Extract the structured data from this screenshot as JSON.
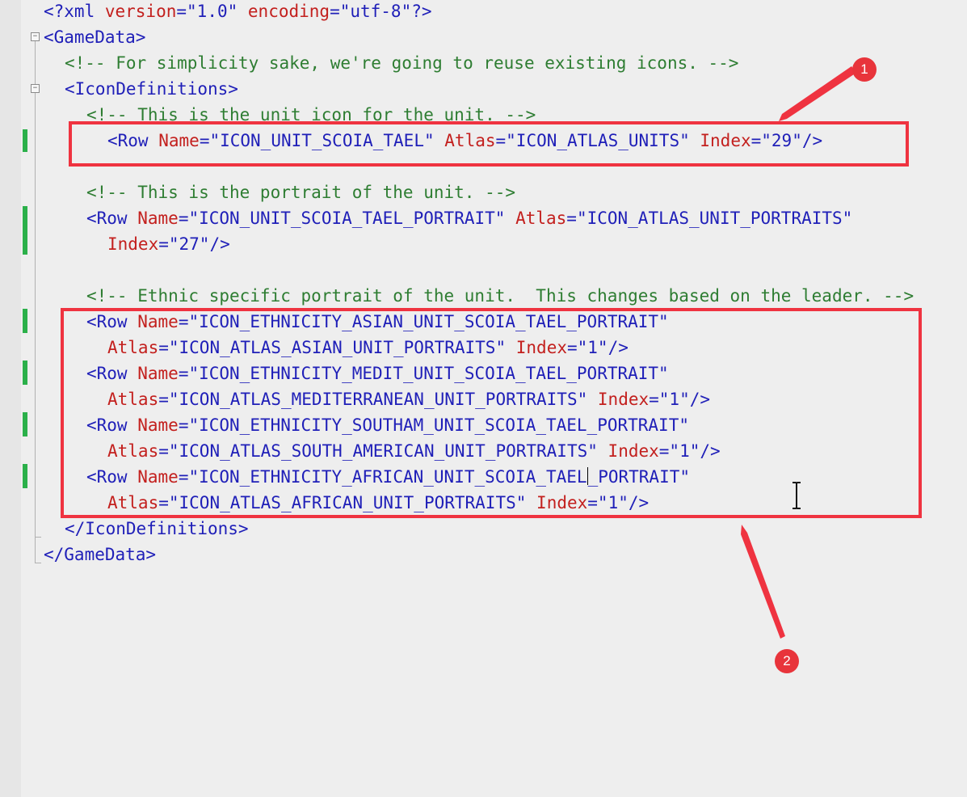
{
  "editor": {
    "declaration": {
      "open": "<?xml ",
      "version_attr": "version",
      "eq": "=",
      "version_val": "\"1.0\"",
      "encoding_attr": "encoding",
      "encoding_val": "\"utf-8\"",
      "close": "?>"
    },
    "root_open": "<GameData>",
    "root_close": "</GameData>",
    "comment_simplicity": "<!-- For simplicity sake, we're going to reuse existing icons. -->",
    "icondefs_open": "<IconDefinitions>",
    "icondefs_close": "</IconDefinitions>",
    "comment_unit_icon": "<!-- This is the unit icon for the unit. -->",
    "comment_portrait": "<!-- This is the portrait of the unit. -->",
    "comment_ethnic": "<!-- Ethnic specific portrait of the unit.  This changes based on the leader. -->",
    "row_tag": "<Row",
    "self_close": "/>",
    "name_attr": "Name",
    "atlas_attr": "Atlas",
    "index_attr": "Index",
    "rows": [
      {
        "name": "\"ICON_UNIT_SCOIA_TAEL\"",
        "atlas": "\"ICON_ATLAS_UNITS\"",
        "index": "\"29\""
      },
      {
        "name": "\"ICON_UNIT_SCOIA_TAEL_PORTRAIT\"",
        "atlas": "\"ICON_ATLAS_UNIT_PORTRAITS\"",
        "index": "\"27\""
      },
      {
        "name": "\"ICON_ETHNICITY_ASIAN_UNIT_SCOIA_TAEL_PORTRAIT\"",
        "atlas": "\"ICON_ATLAS_ASIAN_UNIT_PORTRAITS\"",
        "index": "\"1\""
      },
      {
        "name": "\"ICON_ETHNICITY_MEDIT_UNIT_SCOIA_TAEL_PORTRAIT\"",
        "atlas": "\"ICON_ATLAS_MEDITERRANEAN_UNIT_PORTRAITS\"",
        "index": "\"1\""
      },
      {
        "name": "\"ICON_ETHNICITY_SOUTHAM_UNIT_SCOIA_TAEL_PORTRAIT\"",
        "atlas": "\"ICON_ATLAS_SOUTH_AMERICAN_UNIT_PORTRAITS\"",
        "index": "\"1\""
      },
      {
        "name_before_caret": "\"ICON_ETHNICITY_AFRICAN_UNIT_SCOIA_TAEL",
        "name_after_caret": "_PORTRAIT\"",
        "atlas": "\"ICON_ATLAS_AFRICAN_UNIT_PORTRAITS\"",
        "index": "\"1\""
      }
    ]
  },
  "annotations": {
    "badge_1": "1",
    "badge_2": "2",
    "color": "#ef3340"
  },
  "colors": {
    "tag": "#1f1fb8",
    "attribute": "#c3201e",
    "comment": "#2e7d32",
    "change_marker": "#2bb04a"
  },
  "icons": {
    "fold": "minus-box-icon",
    "cursor": "text-cursor-icon"
  }
}
